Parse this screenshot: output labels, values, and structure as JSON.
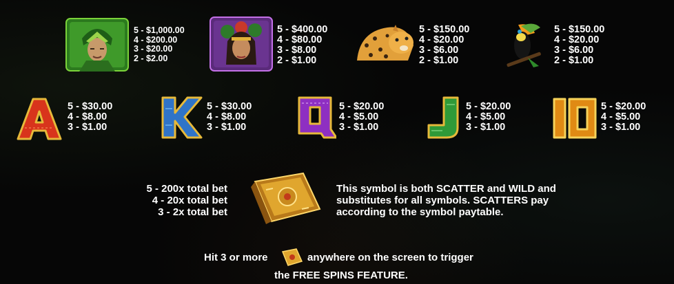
{
  "symbols": [
    {
      "icon": "warrior-man-icon",
      "pays": [
        "5 - $1,000.00",
        "4 - $200.00",
        "3 - $20.00",
        "2 - $2.00"
      ]
    },
    {
      "icon": "warrior-woman-icon",
      "pays": [
        "5 - $400.00",
        "4 - $80.00",
        "3 - $8.00",
        "2 - $1.00"
      ]
    },
    {
      "icon": "jaguar-icon",
      "pays": [
        "5 - $150.00",
        "4 - $20.00",
        "3 - $6.00",
        "2 - $1.00"
      ]
    },
    {
      "icon": "toucan-icon",
      "pays": [
        "5 - $150.00",
        "4 - $20.00",
        "3 - $6.00",
        "2 - $1.00"
      ]
    },
    {
      "icon": "letter-a-icon",
      "letter": "A",
      "pays": [
        "5 - $30.00",
        "4 - $8.00",
        "3 - $1.00"
      ]
    },
    {
      "icon": "letter-k-icon",
      "letter": "K",
      "pays": [
        "5 - $30.00",
        "4 - $8.00",
        "3 - $1.00"
      ]
    },
    {
      "icon": "letter-q-icon",
      "letter": "Q",
      "pays": [
        "5 - $20.00",
        "4 - $5.00",
        "3 - $1.00"
      ]
    },
    {
      "icon": "letter-j-icon",
      "letter": "J",
      "pays": [
        "5 - $20.00",
        "4 - $5.00",
        "3 - $1.00"
      ]
    },
    {
      "icon": "number-10-icon",
      "letter": "10",
      "pays": [
        "5 - $20.00",
        "4 - $5.00",
        "3 - $1.00"
      ]
    }
  ],
  "scatter": {
    "icon": "golden-book-icon",
    "pays": [
      "5 - 200x total bet",
      "4 - 20x total bet",
      "3 - 2x total bet"
    ],
    "description": [
      "This symbol is both SCATTER and WILD and",
      "substitutes for all symbols. SCATTERS pay",
      "according to the symbol paytable."
    ]
  },
  "free_spins": {
    "before": "Hit 3 or more",
    "after": "anywhere on the screen to trigger",
    "line2": "the FREE SPINS FEATURE."
  },
  "colors": {
    "a": "#d8341c",
    "k": "#2f74c8",
    "q": "#8e2fc2",
    "j": "#2f9a38",
    "ten": "#e08a14",
    "gold": "#e6b93a"
  }
}
